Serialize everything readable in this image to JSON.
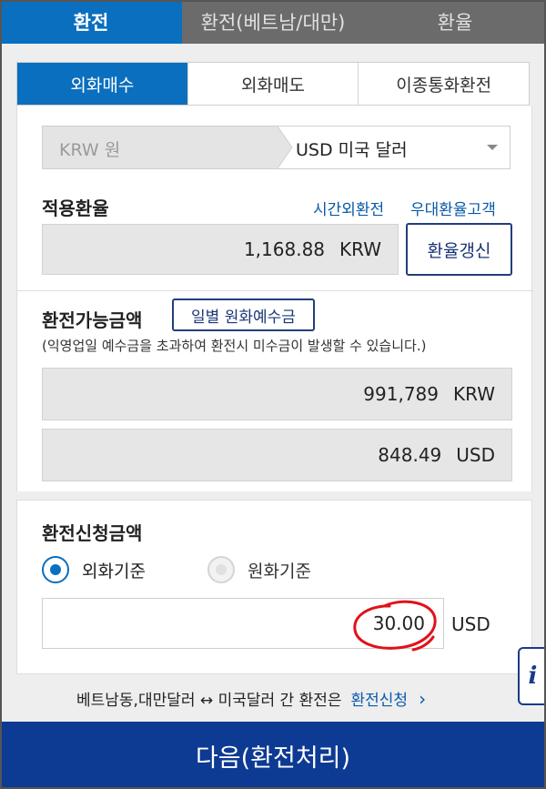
{
  "top_tabs": [
    "환전",
    "환전(베트남/대만)",
    "환율"
  ],
  "sub_tabs": [
    "외화매수",
    "외화매도",
    "이종통화환전"
  ],
  "currency": {
    "from": "KRW 원",
    "to": "USD 미국 달러"
  },
  "rate_section": {
    "title": "적용환율",
    "link1": "시간외환전",
    "link2": "우대환율고객",
    "value": "1,168.88",
    "unit": "KRW",
    "refresh_button": "환율갱신"
  },
  "available_section": {
    "title": "환전가능금액",
    "daily_button": "일별 원화예수금",
    "note": "(익영업일 예수금을 초과하여 환전시 미수금이 발생할 수 있습니다.)",
    "krw_value": "991,789",
    "krw_unit": "KRW",
    "usd_value": "848.49",
    "usd_unit": "USD"
  },
  "request_section": {
    "title": "환전신청금액",
    "radio_foreign": "외화기준",
    "radio_won": "원화기준",
    "amount": "30.00",
    "amount_unit": "USD"
  },
  "info_line": {
    "text": "베트남동,대만달러 ↔ 미국달러 간 환전은",
    "link": "환전신청"
  },
  "info_icon": "i",
  "next_button": "다음(환전처리)",
  "colors": {
    "primary": "#0a6fbf",
    "navy": "#0d3a93",
    "annotation": "#e0121a"
  }
}
